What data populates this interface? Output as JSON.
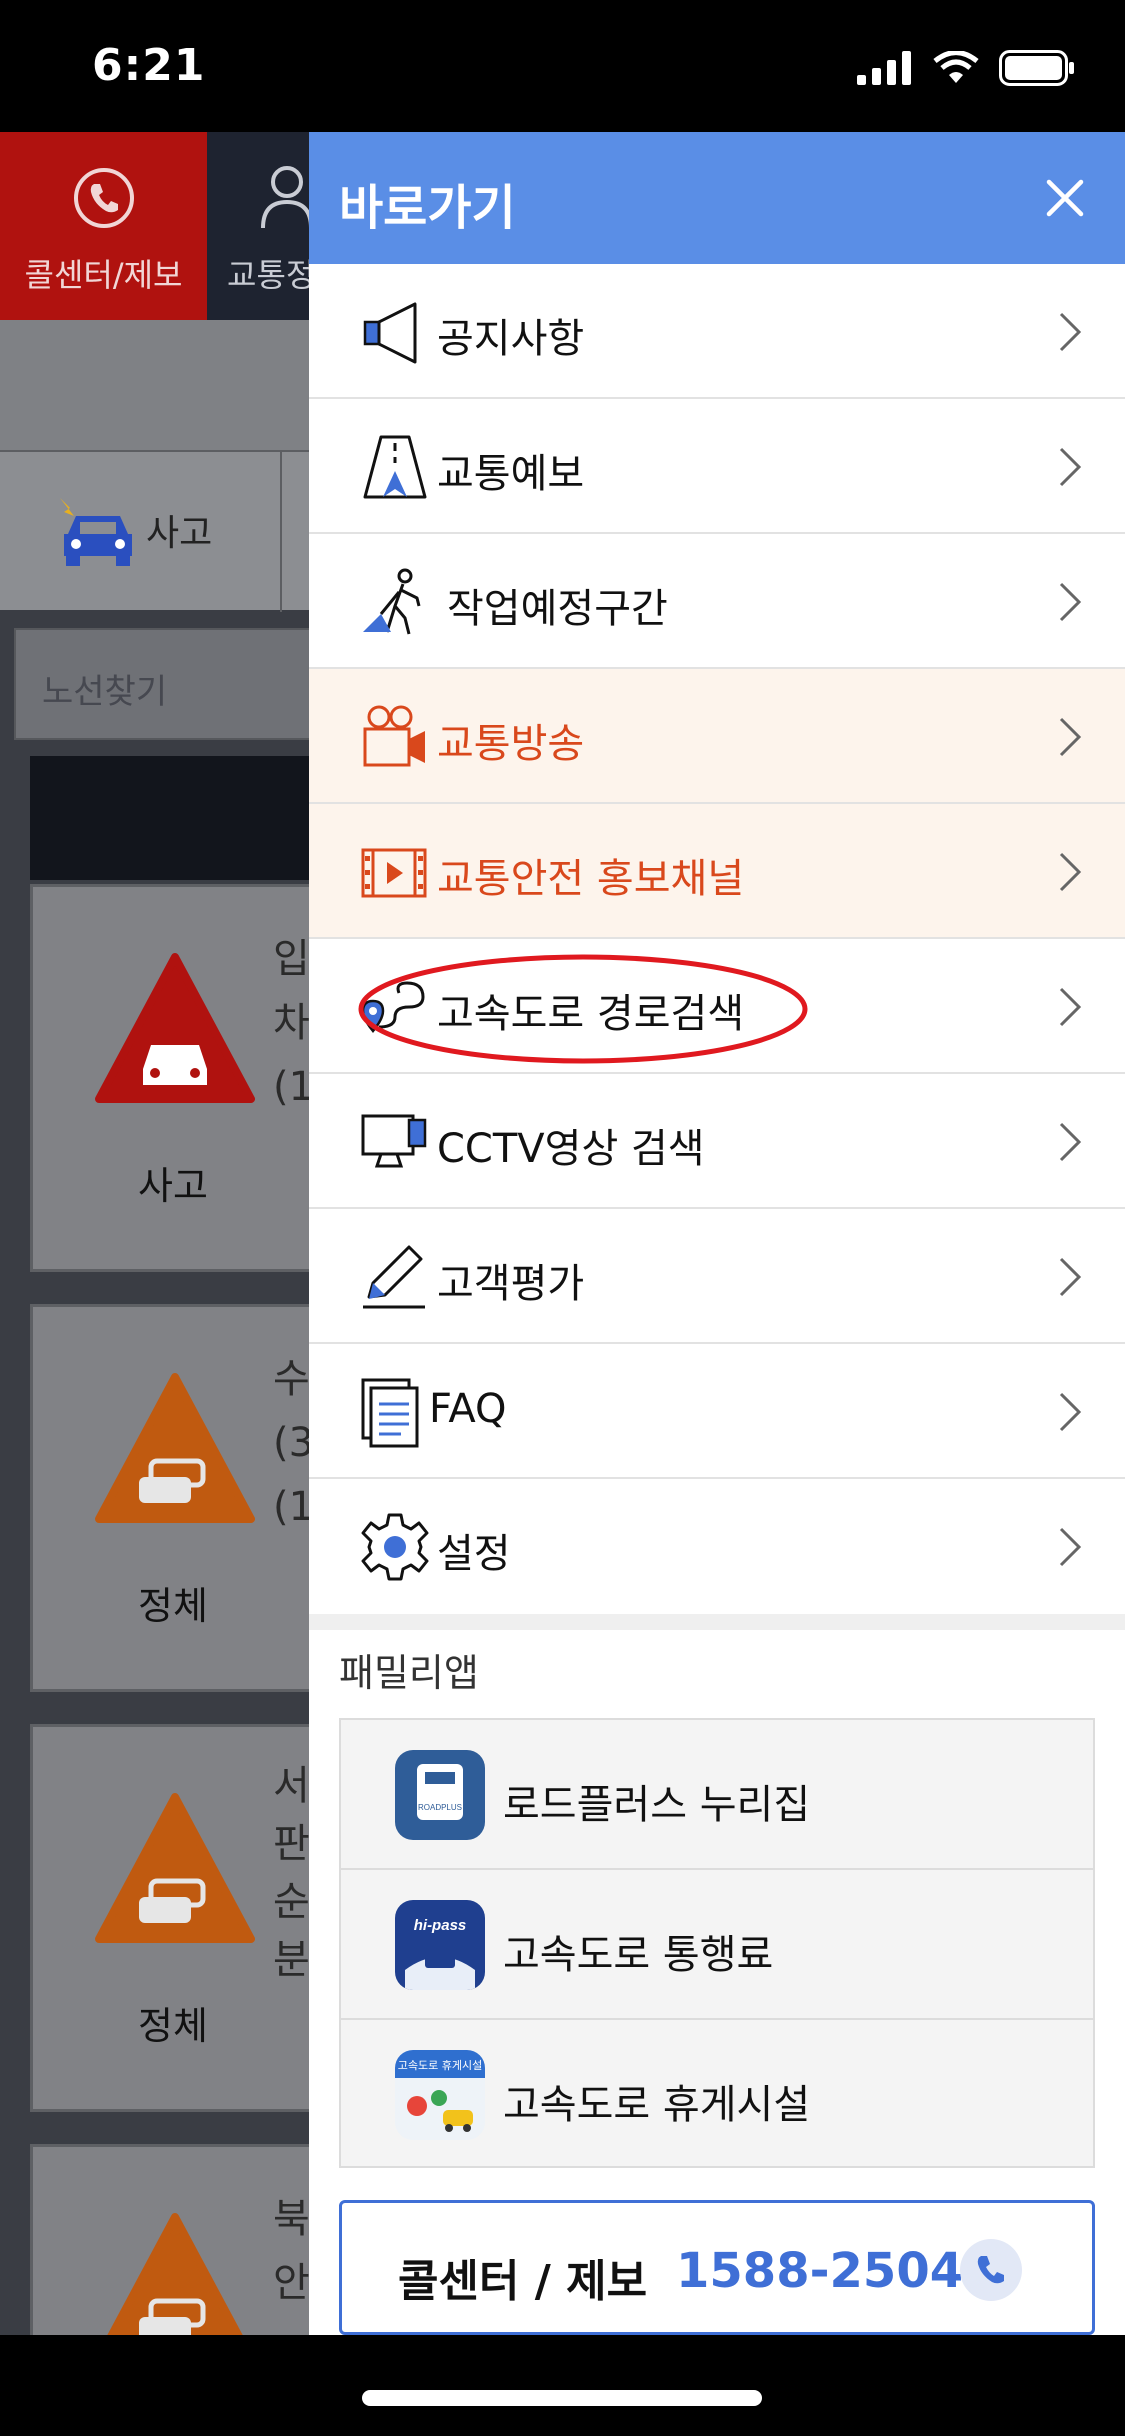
{
  "status_bar": {
    "time": "6:21"
  },
  "background": {
    "callcenter_label": "콜센터/제보",
    "traffic_label": "교통정",
    "accident_tab_label": "사고",
    "search_placeholder": "노선찾기",
    "cards": [
      {
        "type_label": "사고",
        "desc": [
          "입",
          "차",
          "(1"
        ],
        "color": "#b0120f"
      },
      {
        "type_label": "정체",
        "desc": [
          "수",
          "(3",
          "(1"
        ],
        "color": "#c05a10"
      },
      {
        "type_label": "정체",
        "desc": [
          "서",
          "판",
          "순",
          "분"
        ],
        "color": "#c05a10"
      },
      {
        "type_label": "",
        "desc": [
          "북",
          "안"
        ],
        "color": "#c05a10"
      }
    ]
  },
  "drawer": {
    "title": "바로가기",
    "accent_color": "#5a8ee6",
    "menu_items": [
      {
        "label": "공지사항",
        "icon": "megaphone-icon"
      },
      {
        "label": "교통예보",
        "icon": "road-forecast-icon"
      },
      {
        "label": "작업예정구간",
        "icon": "roadwork-icon"
      },
      {
        "label": "교통방송",
        "icon": "video-camera-icon",
        "highlight": true
      },
      {
        "label": "교통안전 홍보채널",
        "icon": "film-icon",
        "highlight": true
      },
      {
        "label": "고속도로 경로검색",
        "icon": "route-pin-icon",
        "circled": true
      },
      {
        "label": "CCTV영상 검색",
        "icon": "monitor-icon"
      },
      {
        "label": "고객평가",
        "icon": "pencil-icon"
      },
      {
        "label": "FAQ",
        "icon": "document-icon"
      },
      {
        "label": "설정",
        "icon": "gear-icon"
      }
    ],
    "family_title": "패밀리앱",
    "family_apps": [
      {
        "label": "로드플러스 누리집",
        "icon": "roadplus-app-icon",
        "icon_text": "ROADPLUS"
      },
      {
        "label": "고속도로 통행료",
        "icon": "hipass-app-icon",
        "icon_text": "hi-pass"
      },
      {
        "label": "고속도로 휴게시설",
        "icon": "rest-area-app-icon",
        "icon_text": "고속도로 휴게시설"
      }
    ],
    "callcenter": {
      "label": "콜센터 / 제보",
      "number": "1588-2504"
    }
  }
}
